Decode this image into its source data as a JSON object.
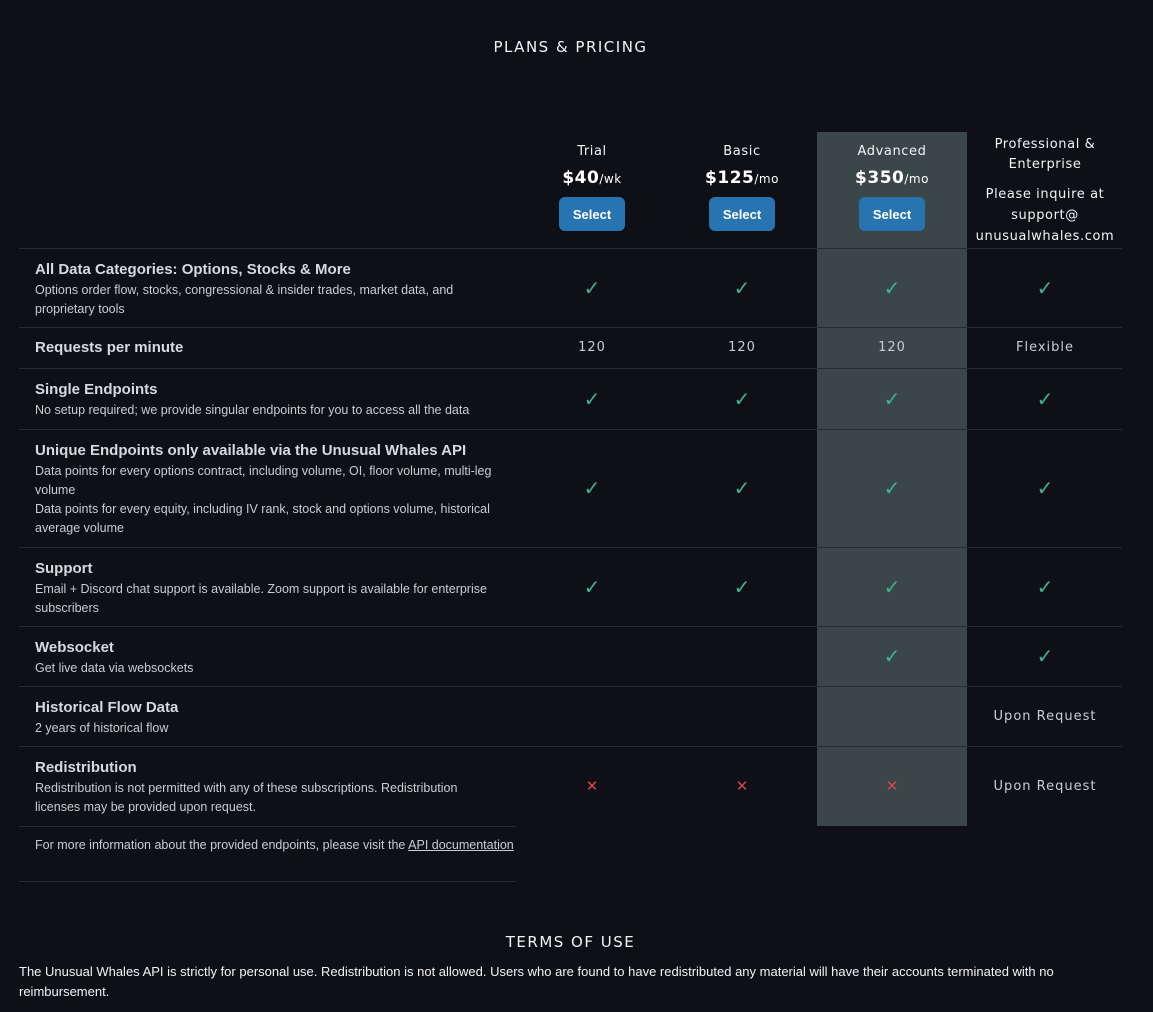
{
  "page_title": "PLANS & PRICING",
  "plans": [
    {
      "name": "Trial",
      "price": "$40",
      "period": "/wk",
      "button": "Select"
    },
    {
      "name": "Basic",
      "price": "$125",
      "period": "/mo",
      "button": "Select"
    },
    {
      "name": "Advanced",
      "price": "$350",
      "period": "/mo",
      "button": "Select"
    }
  ],
  "pro": {
    "name_line1": "Professional &",
    "name_line2": "Enterprise",
    "contact_line1": "Please inquire at",
    "contact_line2": "support@",
    "contact_line3": "unusualwhales.com"
  },
  "rows": [
    {
      "title": "All Data Categories: Options, Stocks & More",
      "desc": "Options order flow, stocks, congressional & insider trades, market data, and proprietary tools",
      "cells": [
        "check",
        "check",
        "check",
        "check"
      ]
    },
    {
      "title": "Requests per minute",
      "desc": "",
      "cells": [
        "120",
        "120",
        "120",
        "Flexible"
      ]
    },
    {
      "title": "Single Endpoints",
      "desc": "No setup required; we provide singular endpoints for you to access all the data",
      "cells": [
        "check",
        "check",
        "check",
        "check"
      ]
    },
    {
      "title": "Unique Endpoints only available via the Unusual Whales API",
      "desc": "Data points for every options contract, including volume, OI, floor volume, multi-leg volume",
      "desc2": "Data points for every equity, including IV rank, stock and options volume, historical average volume",
      "cells": [
        "check",
        "check",
        "check",
        "check"
      ]
    },
    {
      "title": "Support",
      "desc": "Email + Discord chat support is available. Zoom support is available for enterprise subscribers",
      "cells": [
        "check",
        "check",
        "check",
        "check"
      ]
    },
    {
      "title": "Websocket",
      "desc": "Get live data via websockets",
      "cells": [
        "",
        "",
        "check",
        "check"
      ]
    },
    {
      "title": "Historical Flow Data",
      "desc": "2 years of historical flow",
      "cells": [
        "",
        "",
        "",
        "Upon Request"
      ]
    },
    {
      "title": "Redistribution",
      "desc": "Redistribution is not permitted with any of these subscriptions. Redistribution licenses may be provided upon request.",
      "cells": [
        "cross",
        "cross",
        "cross",
        "Upon Request"
      ]
    }
  ],
  "footer": {
    "text": "For more information about the provided endpoints, please visit the ",
    "link": "API documentation"
  },
  "terms": {
    "title": "TERMS OF USE",
    "text": "The Unusual Whales API is strictly for personal use. Redistribution is not allowed. Users who are found to have redistributed any material will have their accounts terminated with no reimbursement."
  },
  "colors": {
    "background": "#0e1016",
    "highlight": "#3b4649",
    "button": "#2774b0",
    "check": "#3fb38c",
    "cross": "#d9434f"
  },
  "icons": {
    "check": "check-icon",
    "cross": "cross-icon"
  }
}
